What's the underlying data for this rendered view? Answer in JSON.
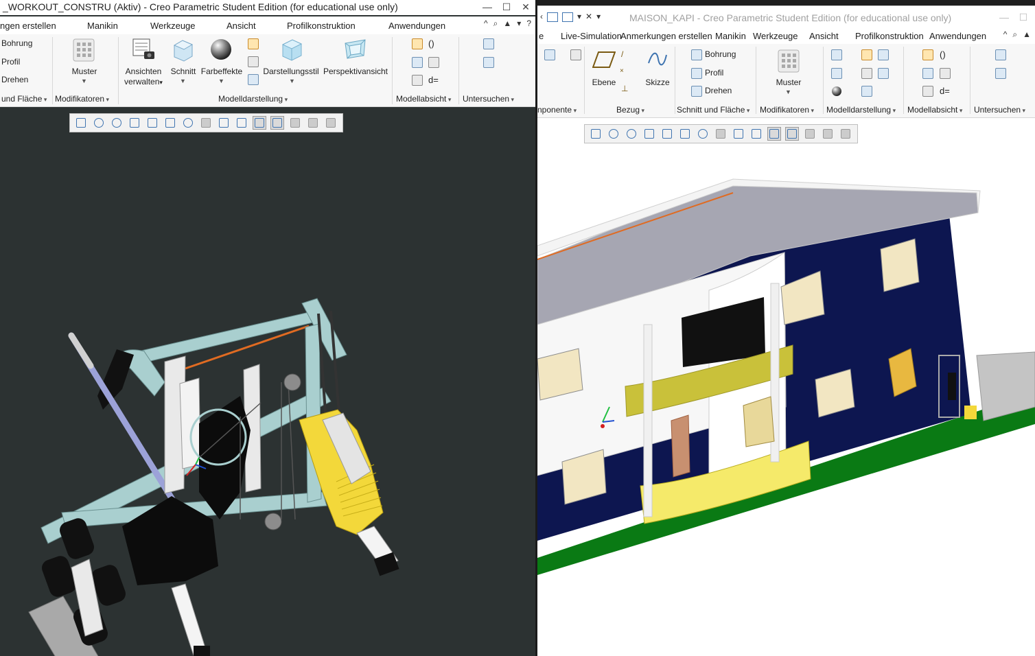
{
  "left_window": {
    "title": "_WORKOUT_CONSTRU (Aktiv) - Creo Parametric Student Edition (for educational use only)",
    "window_controls": [
      "—",
      "☐",
      "✕"
    ],
    "menu_tabs": [
      "ngen erstellen",
      "Manikin",
      "Werkzeuge",
      "Ansicht",
      "Profilkonstruktion",
      "Anwendungen"
    ],
    "menu_icons": [
      "^",
      "⌕",
      "▲",
      "▾",
      "?"
    ],
    "ribbon": {
      "bezug_items": [
        "Bohrung",
        "Profil",
        "Drehen"
      ],
      "muster": "Muster",
      "ansichten_verwalten": [
        "Ansichten",
        "verwalten"
      ],
      "schnitt": "Schnitt",
      "farbeffekte": "Farbeffekte",
      "darstellungsstil": "Darstellungsstil",
      "perspektivansicht": "Perspektivansicht",
      "groups": [
        "und Fläche",
        "Modifikatoren",
        "Modelldarstellung",
        "Modellabsicht",
        "Untersuchen"
      ],
      "modellabsicht_icons": [
        "()",
        "d="
      ]
    },
    "view_toolbar_icons": [
      "refit-icon",
      "zoom-in-icon",
      "zoom-out-icon",
      "repaint-icon",
      "spin-center-icon",
      "named-view-icon",
      "view-manager-icon",
      "saved-orientations-icon",
      "display-style-icon",
      "datum-display-icon",
      "annotation-icon",
      "plane-display-icon",
      "spin-icon",
      "pause-icon",
      "stop-icon"
    ],
    "view_toolbar_active": [
      10,
      11
    ]
  },
  "right_window": {
    "title": "MAISON_KAPI - Creo Parametric Student Edition (for educational use only)",
    "quick_access": [
      "‹",
      "⇆",
      "▾",
      "✕",
      "▾"
    ],
    "window_controls": [
      "—",
      "☐",
      "✕"
    ],
    "menu_tabs": [
      "e",
      "Live-Simulation",
      "Anmerkungen erstellen",
      "Manikin",
      "Werkzeuge",
      "Ansicht",
      "Profilkonstruktion",
      "Anwendungen"
    ],
    "menu_icons": [
      "^",
      "⌕",
      "▲"
    ],
    "ribbon": {
      "ebene": "Ebene",
      "skizze": "Skizze",
      "bezug_items": [
        "Bohrung",
        "Profil",
        "Drehen"
      ],
      "muster": "Muster",
      "groups": [
        "nponente",
        "Bezug",
        "Schnitt und Fläche",
        "Modifikatoren",
        "Modelldarstellung",
        "Modellabsicht",
        "Untersuchen"
      ],
      "modellabsicht_icons": [
        "()",
        "d="
      ]
    },
    "view_toolbar_icons": [
      "refit-icon",
      "zoom-in-icon",
      "zoom-out-icon",
      "repaint-icon",
      "spin-center-icon",
      "named-view-icon",
      "view-manager-icon",
      "saved-orientations-icon",
      "display-style-icon",
      "datum-display-icon",
      "annotation-icon",
      "plane-display-icon",
      "spin-icon",
      "pause-icon",
      "stop-icon"
    ],
    "view_toolbar_active": [
      10,
      11
    ]
  },
  "colors": {
    "viewport_dark": "#2c3232",
    "machine_frame": "#a9cfcf",
    "weight_stack": "#f3d83a",
    "house_wall": "#0d1650",
    "roof": "#a6a6b2",
    "lawn": "#0a7a14",
    "balcony_glass": "#c9c13a"
  }
}
